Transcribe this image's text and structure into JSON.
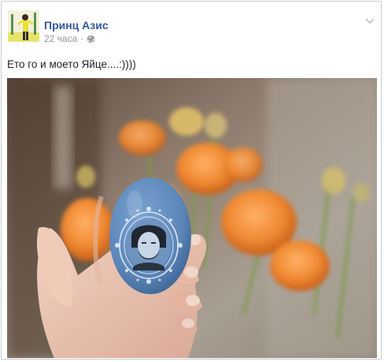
{
  "post": {
    "author_name": "Принц Азис",
    "timestamp": "22 часа",
    "separator": "·",
    "privacy_icon": "globe-icon",
    "options_icon": "chevron-down-icon",
    "text": "Ето го и моето Яйце....:))))"
  },
  "colors": {
    "author_link": "#365899",
    "meta_gray": "#90949c",
    "text": "#1d2129",
    "border": "#c8ccd4",
    "egg_blue": "#5b86b8"
  }
}
